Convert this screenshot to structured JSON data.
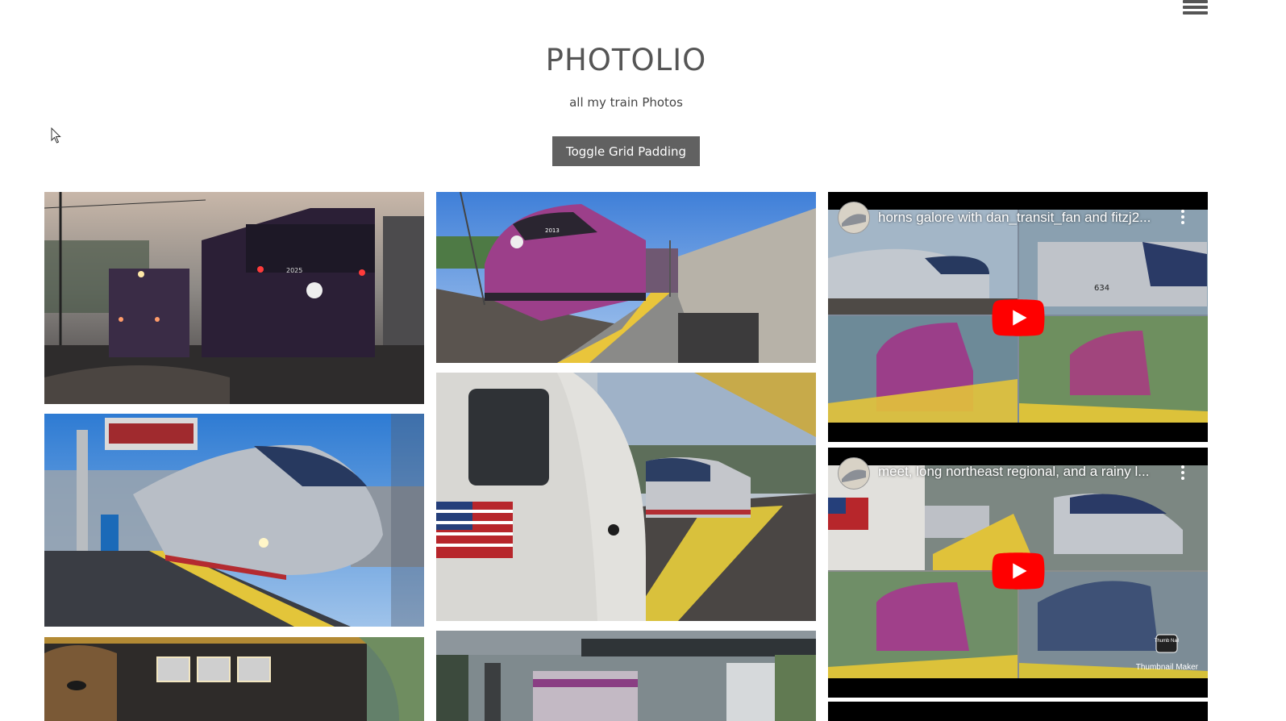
{
  "header": {
    "title": "PHOTOLIO",
    "subtitle": "all my train Photos",
    "toggle_label": "Toggle Grid Padding",
    "menu_icon": "hamburger-icon"
  },
  "colors": {
    "button_bg": "#616161",
    "title_text": "#555555",
    "youtube_red": "#ff0000"
  },
  "gallery": {
    "photos": [
      {
        "name": "mbta-locomotives-dusk",
        "label_text": "2025"
      },
      {
        "name": "mbta-locomotive-platform",
        "label_text": "2013"
      },
      {
        "name": "acela-express-station"
      },
      {
        "name": "amtrak-602-and-acs64"
      },
      {
        "name": "painted-locomotive-pharaoh"
      },
      {
        "name": "mbta-commuter-station-bridge"
      }
    ],
    "videos": [
      {
        "title": "horns galore with dan_transit_fan and fitzj2...",
        "num": "634"
      },
      {
        "title": "meet, long northeast regional, and a rainy l...",
        "badge": "Thumbnail Maker",
        "badge_logo": "Thumb Nail"
      }
    ]
  }
}
